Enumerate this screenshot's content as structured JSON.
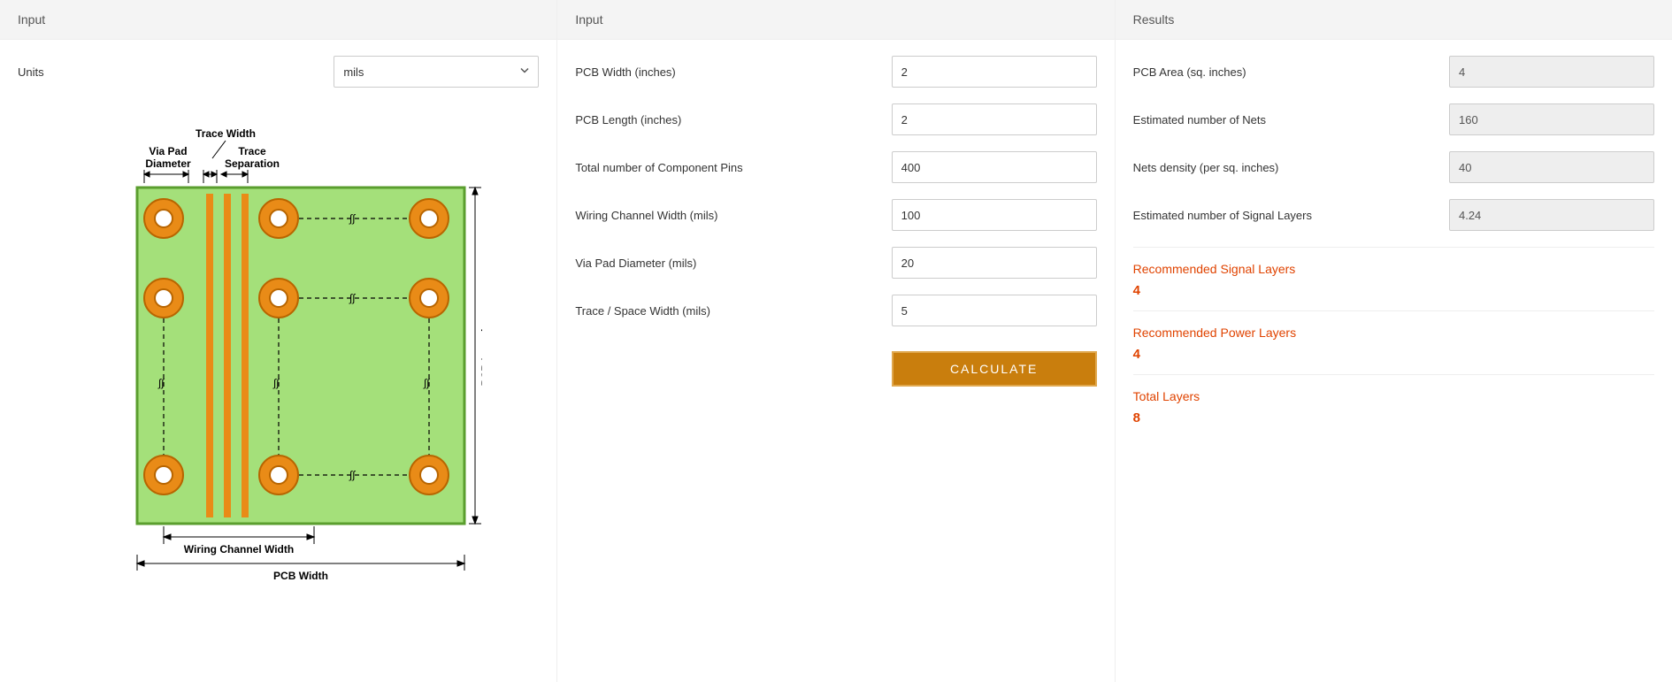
{
  "left": {
    "title": "Input",
    "units_label": "Units",
    "units_value": "mils",
    "diagram": {
      "trace_width": "Trace Width",
      "via_pad_diameter": "Via Pad\nDiameter",
      "trace_separation": "Trace\nSeparation",
      "pcb_length": "PCB Length",
      "wiring_channel_width": "Wiring Channel Width",
      "pcb_width": "PCB Width"
    }
  },
  "mid": {
    "title": "Input",
    "fields": {
      "pcb_width": {
        "label": "PCB Width (inches)",
        "value": "2"
      },
      "pcb_length": {
        "label": "PCB Length (inches)",
        "value": "2"
      },
      "pins": {
        "label": "Total number of Component Pins",
        "value": "400"
      },
      "chan_width": {
        "label": "Wiring Channel Width (mils)",
        "value": "100"
      },
      "via_pad": {
        "label": "Via Pad Diameter (mils)",
        "value": "20"
      },
      "trace_space": {
        "label": "Trace / Space Width (mils)",
        "value": "5"
      }
    },
    "calculate": "CALCULATE"
  },
  "results": {
    "title": "Results",
    "fields": {
      "area": {
        "label": "PCB Area (sq. inches)",
        "value": "4"
      },
      "nets": {
        "label": "Estimated number of Nets",
        "value": "160"
      },
      "density": {
        "label": "Nets density (per sq. inches)",
        "value": "40"
      },
      "sig_layers": {
        "label": "Estimated number of Signal Layers",
        "value": "4.24"
      }
    },
    "rec_signal": {
      "title": "Recommended Signal Layers",
      "value": "4"
    },
    "rec_power": {
      "title": "Recommended Power Layers",
      "value": "4"
    },
    "total": {
      "title": "Total Layers",
      "value": "8"
    }
  }
}
